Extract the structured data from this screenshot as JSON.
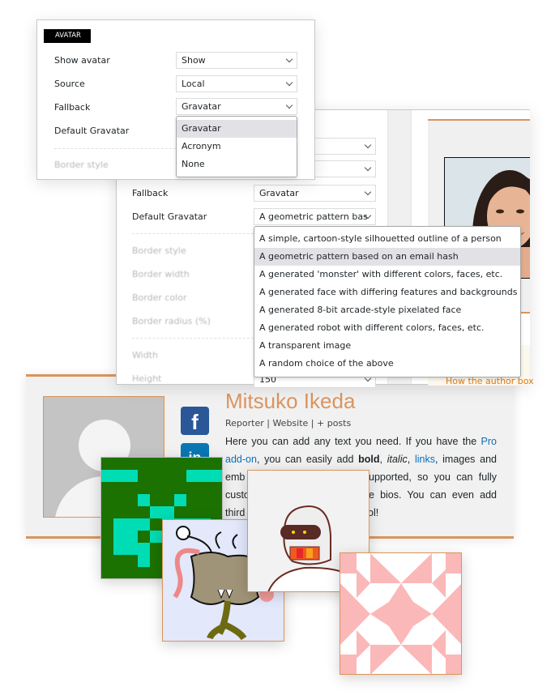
{
  "panel_a": {
    "badge": "AVATAR",
    "rows": [
      {
        "label": "Show avatar",
        "value": "Show"
      },
      {
        "label": "Source",
        "value": "Local"
      },
      {
        "label": "Fallback",
        "value": "Gravatar"
      },
      {
        "label": "Default Gravatar"
      }
    ],
    "faded_label": "Border style",
    "fallback_options": [
      "Gravatar",
      "Acronym",
      "None"
    ],
    "fallback_highlighted": "Gravatar"
  },
  "panel_b": {
    "rows": [
      {
        "label": "Fallback",
        "value": "Gravatar"
      },
      {
        "label": "Default Gravatar",
        "value": "A geometric pattern bas"
      }
    ],
    "faded_labels": [
      "Border style",
      "Border width",
      "Border color",
      "Border radius (%)",
      "Width",
      "Height"
    ],
    "height_value": "150",
    "gravatar_options": [
      "A simple, cartoon-style silhouetted outline of a person",
      "A geometric pattern based on an email hash",
      "A generated 'monster' with different colors, faces, etc.",
      "A generated face with differing features and backgrounds",
      "A generated 8-bit arcade-style pixelated face",
      "A generated robot with different colors, faces, etc.",
      "A transparent image",
      "A random choice of the above"
    ],
    "gravatar_highlighted": "A geometric pattern based on an email hash",
    "preview_link": "How the author box"
  },
  "author_box": {
    "name": "Mitsuko Ikeda",
    "meta": "Reporter | Website | + posts",
    "social": [
      "facebook-icon",
      "linkedin-icon"
    ],
    "bio": {
      "l1a": "Here you can add any text you need. If you have the ",
      "l1b": "Pro",
      "l2a": "add-on",
      "l2b": ", you can easily add ",
      "l2c": "bold",
      "l2d": ", ",
      "l2e": "italic",
      "l2f": ", ",
      "l2g": "links",
      "l2h": ", images and",
      "l3a": "emb",
      "l3b": "upported, so you can fully",
      "l4a": "custo",
      "l4b": "e bios. You can even add",
      "l5a": "third",
      "l5b": "ol!"
    }
  },
  "colors": {
    "accent": "#dc9460",
    "link": "#0a6ebd",
    "facebook": "#2a5797",
    "linkedin": "#0a77b5"
  }
}
